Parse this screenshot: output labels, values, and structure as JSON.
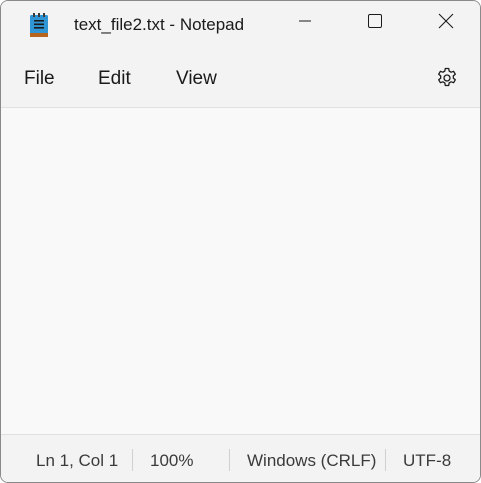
{
  "window": {
    "title": "text_file2.txt - Notepad"
  },
  "title_icons": {
    "app": "notepad-icon",
    "minimize": "minimize-icon",
    "maximize": "maximize-icon",
    "close": "close-icon"
  },
  "menu": {
    "items": [
      {
        "label": "File"
      },
      {
        "label": "Edit"
      },
      {
        "label": "View"
      }
    ],
    "settings_icon": "gear-icon"
  },
  "editor": {
    "content": ""
  },
  "status": {
    "position": "Ln 1, Col 1",
    "zoom": "100%",
    "line_ending": "Windows (CRLF)",
    "encoding": "UTF-8"
  },
  "colors": {
    "chrome": "#f3f3f3",
    "editor_bg": "#f9f9f9",
    "icon_blue": "#2f95d5"
  }
}
